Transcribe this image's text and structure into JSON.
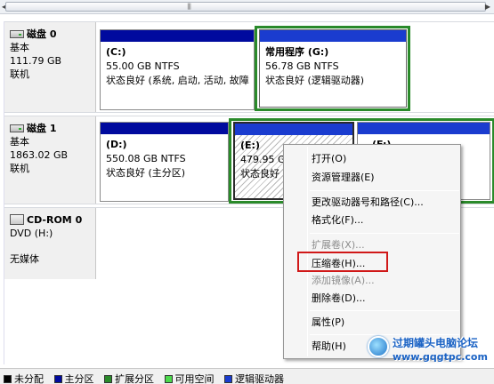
{
  "disks": [
    {
      "name": "磁盘 0",
      "type": "基本",
      "size": "111.79 GB",
      "status": "联机"
    },
    {
      "name": "磁盘 1",
      "type": "基本",
      "size": "1863.02 GB",
      "status": "联机"
    },
    {
      "name": "CD-ROM 0",
      "type": "DVD (H:)",
      "size": "",
      "status": "无媒体"
    }
  ],
  "partitions": {
    "c": {
      "label": "(C:)",
      "size": "55.00 GB NTFS",
      "status": "状态良好 (系统, 启动, 活动, 故障"
    },
    "g": {
      "label": "常用程序  (G:)",
      "size": "56.78 GB NTFS",
      "status": "状态良好 (逻辑驱动器)"
    },
    "d": {
      "label": "(D:)",
      "size": "550.08 GB NTFS",
      "status": "状态良好 (主分区)"
    },
    "e": {
      "label": "(E:)",
      "size": "479.95 GB",
      "status": "状态良好"
    },
    "f": {
      "label": "(F:)"
    }
  },
  "context_menu": {
    "open": "打开(O)",
    "explorer": "资源管理器(E)",
    "change_letter": "更改驱动器号和路径(C)...",
    "format": "格式化(F)...",
    "extend": "扩展卷(X)...",
    "shrink": "压缩卷(H)...",
    "add_mirror": "添加镜像(A)...",
    "delete": "删除卷(D)...",
    "properties": "属性(P)",
    "help": "帮助(H)"
  },
  "legend": [
    {
      "label": "未分配",
      "color": "#000000"
    },
    {
      "label": "主分区",
      "color": "#000a9e"
    },
    {
      "label": "扩展分区",
      "color": "#2a8a2a"
    },
    {
      "label": "可用空间",
      "color": "#4cd94c"
    },
    {
      "label": "逻辑驱动器",
      "color": "#1a3ccf"
    }
  ],
  "watermark": {
    "title": "过期罐头电脑论坛",
    "url": "www.gqgtpc.com"
  },
  "colors": {
    "primary_bar": "#000a9e",
    "extended_frame": "#2a8a2a",
    "highlight": "#d01818"
  }
}
